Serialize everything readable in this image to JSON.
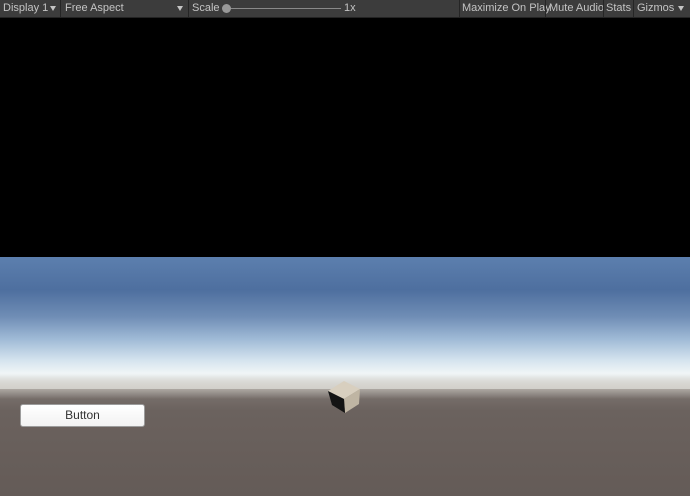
{
  "toolbar": {
    "display": "Display 1",
    "aspect": "Free Aspect",
    "scale_label": "Scale",
    "scale_value": "1x",
    "scale_level": 0.0,
    "maximize_on_play": "Maximize On Play",
    "mute_audio": "Mute Audio",
    "stats": "Stats",
    "gizmos": "Gizmos"
  },
  "game": {
    "button_label": "Button"
  },
  "colors": {
    "toolbar_bg": "#3c3c3c",
    "toolbar_text": "#c4c4c4",
    "letterbox": "#000000",
    "ground": "#645b57"
  },
  "icons": {
    "display_dropdown": "chevron-down-icon",
    "aspect_dropdown": "chevron-down-icon",
    "gizmos_dropdown": "chevron-down-icon"
  }
}
